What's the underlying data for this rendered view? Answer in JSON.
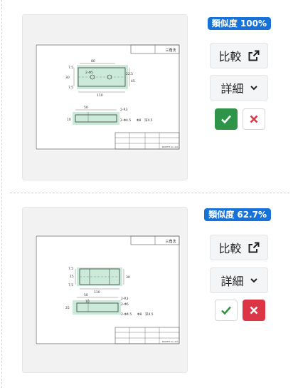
{
  "results": [
    {
      "similarity_label": "類似度 100%",
      "compare_label": "比較",
      "detail_label": "詳細",
      "icons": {
        "compare": "external-link-icon",
        "detail": "chevron-down-icon",
        "approve": "check-icon",
        "reject": "x-icon"
      },
      "approve_state": "selected",
      "reject_state": "unselected",
      "drawing": {
        "title_block_text": "三角法",
        "dims": [
          "7.5",
          "80",
          "30",
          "7.5",
          "110",
          "2-Φ5",
          "22.5",
          "45",
          "50",
          "10",
          "2-R3",
          "2-Φ4.5",
          "Φ8",
          "深4.5"
        ],
        "footer_text": "ROOTH Co.,Ltd."
      }
    },
    {
      "similarity_label": "類似度 62.7%",
      "compare_label": "比較",
      "detail_label": "詳細",
      "icons": {
        "compare": "external-link-icon",
        "detail": "chevron-down-icon",
        "approve": "check-icon",
        "reject": "x-icon"
      },
      "approve_state": "unselected",
      "reject_state": "selected",
      "drawing": {
        "title_block_text": "三角法",
        "dims": [
          "7.5",
          "15",
          "30",
          "7.5",
          "110",
          "50",
          "10",
          "2-R3",
          "25",
          "2-Φ5",
          "2-Φ4.5",
          "Φ8",
          "深4.5"
        ],
        "footer_text": "ROOTH Co.,Ltd."
      }
    }
  ],
  "colors": {
    "badge": "#1672d9",
    "approve": "#2e9447",
    "reject": "#dc3545",
    "highlight": "#a8dcc0"
  }
}
